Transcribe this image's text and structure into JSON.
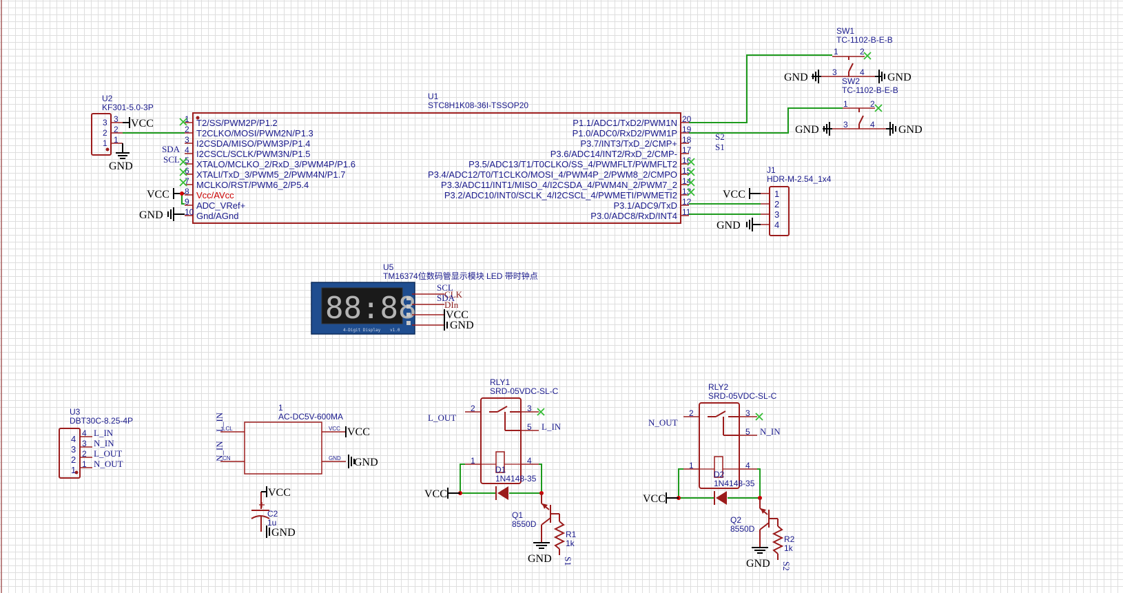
{
  "u1": {
    "ref": "U1",
    "part": "STC8H1K08-36I-TSSOP20",
    "left_pins": [
      {
        "num": "1",
        "name": "T2/SS/PWM2P/P1.2"
      },
      {
        "num": "2",
        "name": "T2CLKO/MOSI/PWM2N/P1.3"
      },
      {
        "num": "3",
        "name": "I2CSDA/MISO/PWM3P/P1.4"
      },
      {
        "num": "4",
        "name": "I2CSCL/SCLK/PWM3N/P1.5"
      },
      {
        "num": "5",
        "name": "XTALO/MCLKO_2/RxD_3/PWM4P/P1.6"
      },
      {
        "num": "6",
        "name": "XTALI/TxD_3/PWM5_2/PWM4N/P1.7"
      },
      {
        "num": "7",
        "name": "MCLKO/RST/PWM6_2/P5.4"
      },
      {
        "num": "8",
        "name": "Vcc/AVcc"
      },
      {
        "num": "9",
        "name": "ADC_VRef+"
      },
      {
        "num": "10",
        "name": "Gnd/AGnd"
      }
    ],
    "right_pins": [
      {
        "num": "20",
        "name": "P1.1/ADC1/TxD2/PWM1N"
      },
      {
        "num": "19",
        "name": "P1.0/ADC0/RxD2/PWM1P"
      },
      {
        "num": "18",
        "name": "P3.7/INT3/TxD_2/CMP+"
      },
      {
        "num": "17",
        "name": "P3.6/ADC14/INT2/RxD_2/CMP-"
      },
      {
        "num": "16",
        "name": "P3.5/ADC13/T1/T0CLKO/SS_4/PWMFLT/PWMFLT2"
      },
      {
        "num": "15",
        "name": "P3.4/ADC12/T0/T1CLKO/MOSI_4/PWM4P_2/PWM8_2/CMPO"
      },
      {
        "num": "14",
        "name": "P3.3/ADC11/INT1/MISO_4/I2CSDA_4/PWM4N_2/PWM7_2"
      },
      {
        "num": "13",
        "name": "P3.2/ADC10/INT0/SCLK_4/I2CSCL_4/PWMETI/PWMETI2"
      },
      {
        "num": "12",
        "name": "P3.1/ADC9/TxD"
      },
      {
        "num": "11",
        "name": "P3.0/ADC8/RxD/INT4"
      }
    ],
    "net_sda": "SDA",
    "net_scl": "SCL",
    "net_s2": "S2",
    "net_s1": "S1"
  },
  "u2": {
    "ref": "U2",
    "part": "KF301-5.0-3P",
    "pins": [
      "3",
      "2",
      "1"
    ]
  },
  "u3": {
    "ref": "U3",
    "part": "DBT30C-8.25-4P",
    "pins": [
      "4",
      "3",
      "2",
      "1"
    ],
    "nets": [
      "L_IN",
      "N_IN",
      "L_OUT",
      "N_OUT"
    ]
  },
  "u5": {
    "ref": "U5",
    "part": "TM16374位数码管显示模块 LED 带时钟点",
    "pins": [
      "CLK",
      "DIn"
    ],
    "nets": [
      "SCL",
      "SDA"
    ],
    "digits": "88:88",
    "caption": "4-Digit Display",
    "ver": "v1.0"
  },
  "j1": {
    "ref": "J1",
    "part": "HDR-M-2.54_1x4",
    "pins": [
      "1",
      "2",
      "3",
      "4"
    ]
  },
  "sw1": {
    "ref": "SW1",
    "part": "TC-1102-B-E-B",
    "pins": [
      "1",
      "2",
      "3",
      "4"
    ]
  },
  "sw2": {
    "ref": "SW2",
    "part": "TC-1102-B-E-B",
    "pins": [
      "1",
      "2",
      "3",
      "4"
    ]
  },
  "psu": {
    "ref": "1",
    "part": "AC-DC5V-600MA",
    "pin_l": "LCL",
    "pin_n": "CN",
    "pin_vcc": "VCC",
    "pin_gnd": "GND",
    "net_l": "L_IN",
    "net_n": "N_IN"
  },
  "c2": {
    "ref": "C2",
    "value": "1u"
  },
  "rly1": {
    "ref": "RLY1",
    "part": "SRD-05VDC-SL-C",
    "pins": [
      "2",
      "3",
      "5",
      "1",
      "4"
    ],
    "net_out": "L_OUT",
    "net_in": "L_IN"
  },
  "rly2": {
    "ref": "RLY2",
    "part": "SRD-05VDC-SL-C",
    "pins": [
      "2",
      "3",
      "5",
      "1",
      "4"
    ],
    "net_out": "N_OUT",
    "net_in": "N_IN"
  },
  "d1": {
    "ref": "D1",
    "part": "1N4148-35"
  },
  "d2": {
    "ref": "D2",
    "part": "1N4148-35"
  },
  "q1": {
    "ref": "Q1",
    "part": "8550D"
  },
  "q2": {
    "ref": "Q2",
    "part": "8550D"
  },
  "r1": {
    "ref": "R1",
    "value": "1k",
    "net": "S1"
  },
  "r2": {
    "ref": "R2",
    "value": "1k",
    "net": "S2"
  },
  "power": {
    "vcc": "VCC",
    "gnd": "GND"
  },
  "colors": {
    "component": "#9b1b1b",
    "wire": "#1c9a1c",
    "text": "#1a1a8c",
    "junction": "#cc0000",
    "no_connect": "#33bb33"
  }
}
